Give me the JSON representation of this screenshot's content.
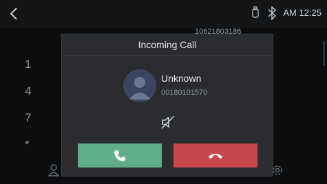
{
  "status_bar": {
    "time": "AM 12:25",
    "icons": [
      "back-icon",
      "phone-device-icon",
      "bluetooth-icon"
    ]
  },
  "background": {
    "recent_number": "10621803186",
    "keypad_keys": [
      "1",
      "4",
      "7",
      "*"
    ],
    "icons": [
      "contacts-icon",
      "settings-gear-icon"
    ]
  },
  "dialog": {
    "title": "Incoming Call",
    "caller_name": "Unknown",
    "caller_number": "00180101570",
    "mute_icon": "speaker-muted-icon",
    "accept_icon": "phone-answer-icon",
    "reject_icon": "phone-hangup-icon"
  },
  "colors": {
    "accept": "#5fae8a",
    "reject": "#c8494c",
    "dialog_bg": "#2a2c2f"
  }
}
